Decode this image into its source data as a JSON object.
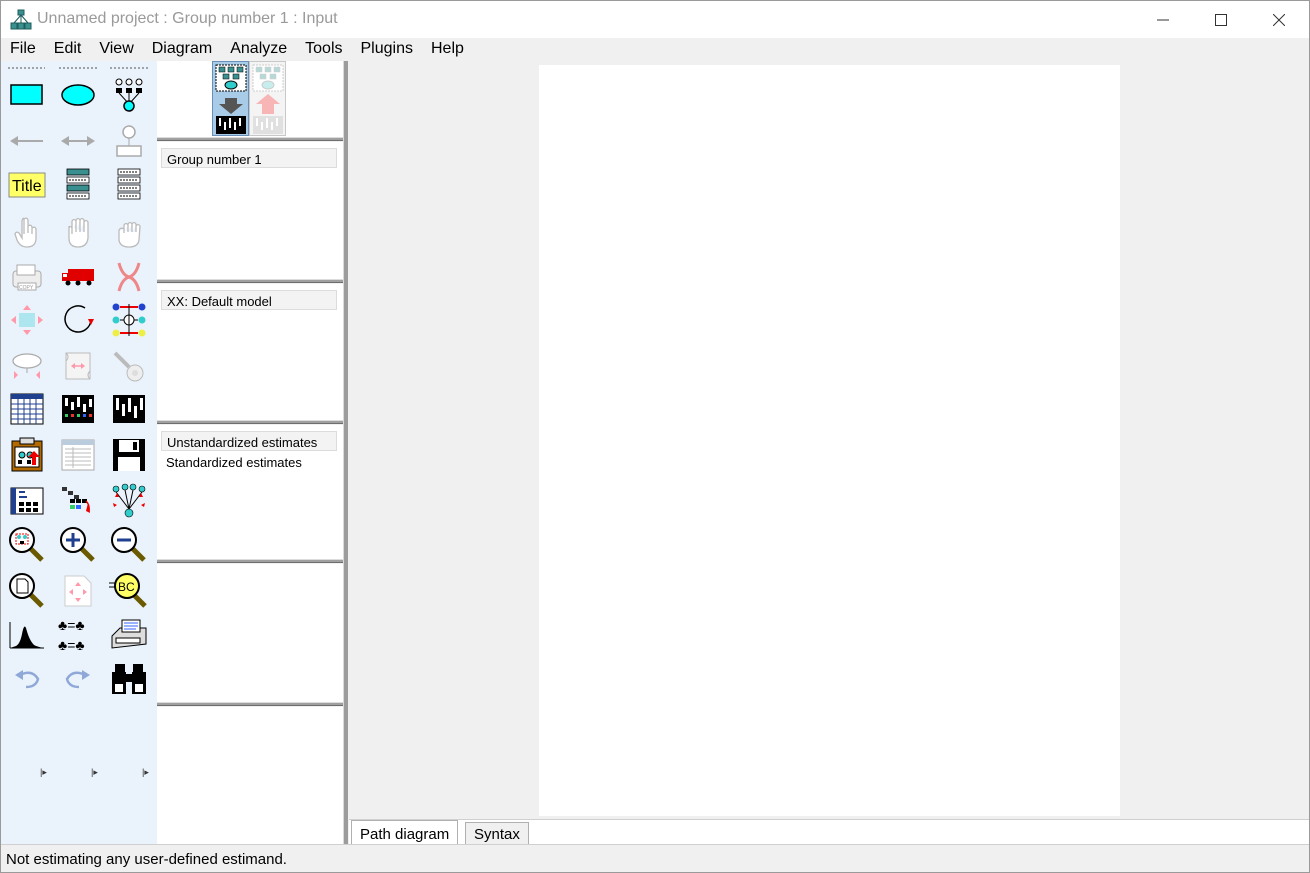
{
  "window": {
    "title": "Unnamed project : Group number 1 : Input",
    "controls": [
      "minimize-icon",
      "maximize-icon",
      "close-icon"
    ]
  },
  "menu": {
    "items": [
      "File",
      "Edit",
      "View",
      "Diagram",
      "Analyze",
      "Tools",
      "Plugins",
      "Help"
    ]
  },
  "toolbox": {
    "tools": [
      "draw-observed-variable-icon",
      "draw-unobserved-variable-icon",
      "draw-latent-indicators-icon",
      "draw-path-icon",
      "draw-covariance-icon",
      "add-unique-variable-icon",
      "figure-caption-icon",
      "list-model-variables-icon",
      "list-dataset-variables-icon",
      "select-one-object-icon",
      "select-all-objects-icon",
      "deselect-all-icon",
      "duplicate-objects-icon",
      "move-objects-icon",
      "erase-objects-icon",
      "change-shape-icon",
      "rotate-indicators-icon",
      "reflect-indicators-icon",
      "move-parameters-icon",
      "reposition-diagram-icon",
      "touch-up-icon",
      "select-data-files-icon",
      "analysis-properties-icon",
      "calculate-estimates-icon",
      "copy-diagram-icon",
      "view-text-icon",
      "save-diagram-icon",
      "object-properties-icon",
      "drag-properties-icon",
      "preserve-symmetries-icon",
      "zoom-selected-area-icon",
      "zoom-in-icon",
      "zoom-out-icon",
      "show-page-icon",
      "resize-diagram-icon",
      "examine-diagram-icon",
      "bayesian-estimation-icon",
      "multiple-group-analysis-icon",
      "print-diagram-icon",
      "undo-icon",
      "redo-icon",
      "specification-search-icon"
    ],
    "title_tool_label": "Title"
  },
  "panels": {
    "groups": [
      "Group number 1"
    ],
    "models": [
      "XX: Default model"
    ],
    "estimates": [
      "Unstandardized estimates",
      "Standardized estimates"
    ]
  },
  "tabs": [
    "Path diagram",
    "Syntax"
  ],
  "status": {
    "text": "Not estimating any user-defined estimand."
  },
  "colors": {
    "accent": "#00ffff",
    "toolbox_bg": "#eaf3fc",
    "title_text": "#9a9a9a"
  }
}
